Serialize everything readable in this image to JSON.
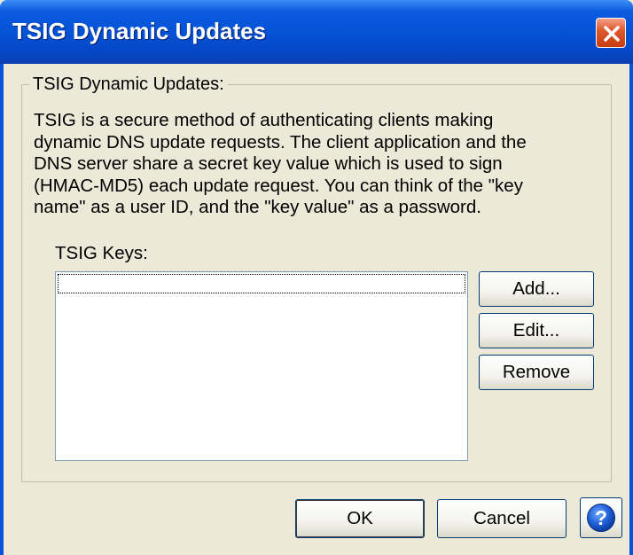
{
  "window": {
    "title": "TSIG Dynamic Updates",
    "close_icon": "close-icon"
  },
  "group": {
    "legend": "TSIG Dynamic Updates:",
    "description_lines": [
      "TSIG is a secure method of authenticating clients making",
      "dynamic DNS update requests. The client application and the",
      "DNS server share a secret key value which is used to sign",
      "(HMAC-MD5) each update request. You can think of the \"key",
      "name\" as a user ID, and the \"key value\" as a password."
    ],
    "keys_label": "TSIG Keys:",
    "keys": []
  },
  "side_buttons": {
    "add": "Add...",
    "edit": "Edit...",
    "remove": "Remove"
  },
  "footer": {
    "ok": "OK",
    "cancel": "Cancel",
    "help_icon": "help-icon"
  },
  "colors": {
    "titlebar": "#0553d6",
    "dialog_background": "#ece9d8",
    "close_button": "#e05a2f",
    "help_icon": "#1f5fd6"
  }
}
